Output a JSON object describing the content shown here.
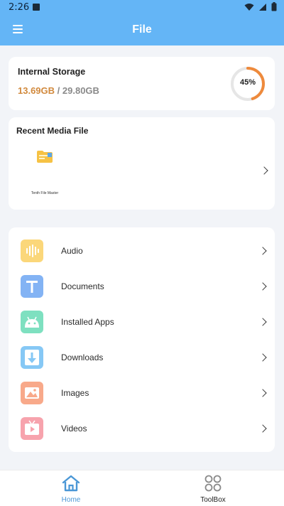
{
  "status_bar": {
    "time": "2:26",
    "icons": [
      "notification-square-icon",
      "wifi-icon",
      "signal-icon",
      "battery-icon"
    ]
  },
  "app_bar": {
    "title": "File",
    "menu_icon": "hamburger-menu-icon"
  },
  "storage": {
    "label": "Internal Storage",
    "used": "13.69GB",
    "separator": " / ",
    "total": "29.80GB",
    "percent_text": "45%",
    "percent_value": 45,
    "gauge_color": "#ee8a3c",
    "gauge_track_color": "#e6e6e6"
  },
  "recent_media": {
    "title": "Recent Media File",
    "items": [
      {
        "label": "Tenth File Master",
        "icon": "folder-file-icon"
      }
    ]
  },
  "categories": [
    {
      "label": "Audio",
      "icon": "audio-wave-icon",
      "color": "#fbd77a"
    },
    {
      "label": "Documents",
      "icon": "text-document-icon",
      "color": "#83b3f4"
    },
    {
      "label": "Installed Apps",
      "icon": "android-icon",
      "color": "#7ee0c0"
    },
    {
      "label": "Downloads",
      "icon": "download-arrow-icon",
      "color": "#86c8f5"
    },
    {
      "label": "Images",
      "icon": "image-mountain-icon",
      "color": "#f8a98a"
    },
    {
      "label": "Videos",
      "icon": "video-play-icon",
      "color": "#f7a3ad"
    }
  ],
  "bottom_nav": {
    "items": [
      {
        "label": "Home",
        "icon": "home-icon",
        "active": true,
        "color": "#4a97d6"
      },
      {
        "label": "ToolBox",
        "icon": "toolbox-grid-icon",
        "active": false,
        "color": "#1f1f1f"
      }
    ]
  }
}
